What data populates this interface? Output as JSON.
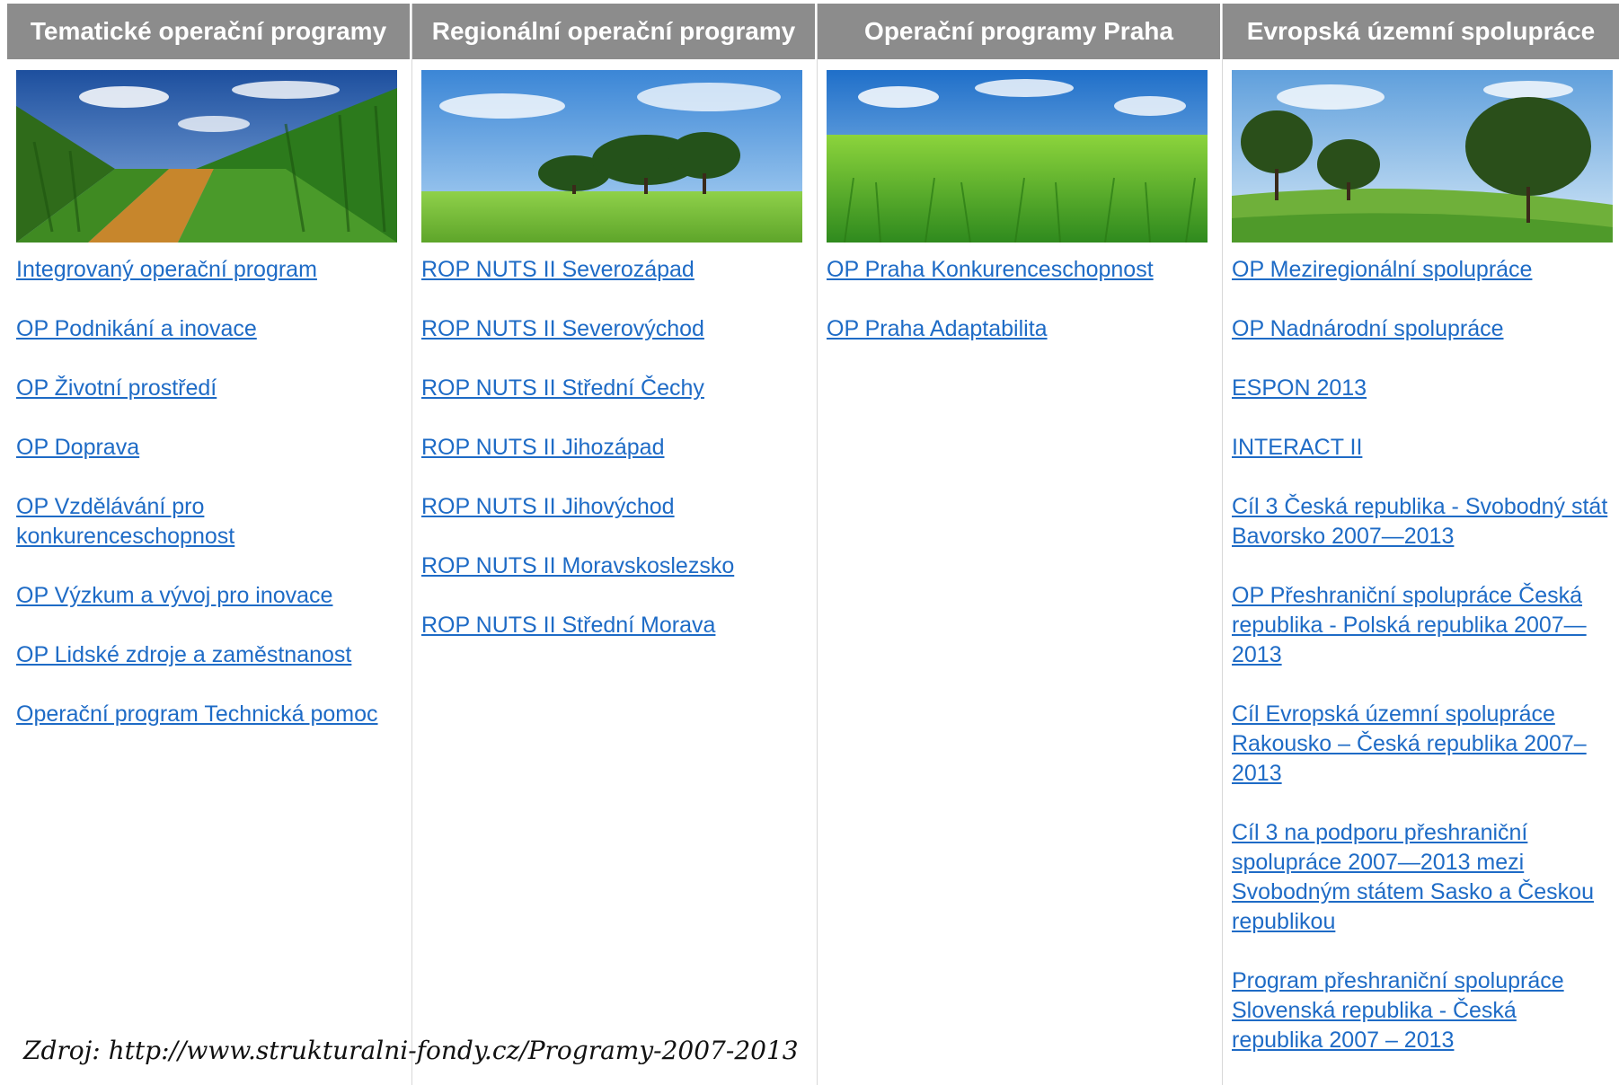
{
  "columns": [
    {
      "header": "Tematické operační programy",
      "image": "corn-field-path",
      "links": [
        "Integrovaný operační program",
        "OP Podnikání a inovace",
        "OP Životní prostředí",
        "OP Doprava",
        "OP Vzdělávání pro konkurenceschopnost",
        "OP Výzkum a vývoj pro inovace",
        "OP Lidské zdroje a zaměstnanost",
        "Operační program Technická pomoc"
      ]
    },
    {
      "header": "Regionální operační programy",
      "image": "trees-on-meadow",
      "links": [
        "ROP NUTS II Severozápad",
        "ROP NUTS II Severovýchod",
        "ROP NUTS II Střední Čechy",
        "ROP NUTS II Jihozápad",
        "ROP NUTS II Jihovýchod",
        "ROP NUTS II Moravskoslezsko",
        "ROP NUTS II Střední Morava"
      ]
    },
    {
      "header": "Operační programy Praha",
      "image": "green-grass-field",
      "links": [
        "OP Praha Konkurenceschopnost",
        "OP Praha Adaptabilita"
      ]
    },
    {
      "header": "Evropská územní spolupráce",
      "image": "trees-on-hill",
      "links": [
        "OP Meziregionální spolupráce",
        "OP Nadnárodní spolupráce",
        "ESPON 2013",
        "INTERACT II",
        "Cíl 3 Česká republika - Svobodný stát Bavorsko 2007—2013",
        "OP Přeshraniční spolupráce Česká republika - Polská republika 2007—2013",
        "Cíl Evropská územní spolupráce Rakousko – Česká republika 2007–2013",
        "Cíl 3 na podporu přeshraniční spolupráce 2007—2013 mezi Svobodným státem Sasko a Českou republikou",
        "Program přeshraniční spolupráce Slovenská republika - Česká republika 2007 – 2013"
      ]
    }
  ],
  "source_note": "Zdroj: http://www.strukturalni-fondy.cz/Programy-2007-2013",
  "colors": {
    "header_bg": "#8c8c8c",
    "link": "#1e6bc6"
  }
}
